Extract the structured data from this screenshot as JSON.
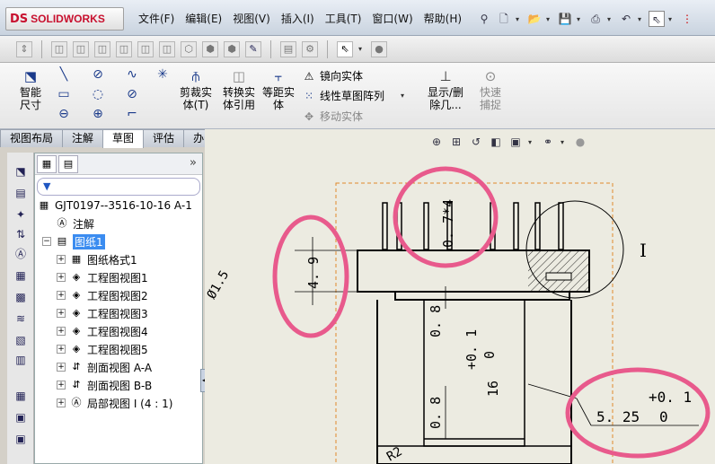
{
  "app": {
    "logo_text": "SOLIDWORKS",
    "logo_mark": "DS"
  },
  "menus": [
    "文件(F)",
    "编辑(E)",
    "视图(V)",
    "插入(I)",
    "工具(T)",
    "窗口(W)",
    "帮助(H)"
  ],
  "command_manager": {
    "smart_dimension": "智能尺寸",
    "trim_entities": "剪裁实体(T)",
    "convert_entities": "转换实体引用",
    "offset_entities": "等距实体",
    "mirror_entities": "镜向实体",
    "linear_pattern": "线性草图阵列",
    "move_entities": "移动实体",
    "show_delete_relations": "显示/删除几...",
    "quick_snaps": "快速捕捉"
  },
  "tabs": [
    "视图布局",
    "注解",
    "草图",
    "评估",
    "办公室产品"
  ],
  "active_tab": "草图",
  "feature_tree": {
    "root": "GJT0197--3516-10-16 A-1",
    "items": [
      {
        "label": "注解",
        "level": 1,
        "icon": "annotation-icon",
        "expand": ""
      },
      {
        "label": "图纸1",
        "level": 1,
        "icon": "sheet-icon",
        "expand": "−",
        "selected": true
      },
      {
        "label": "图纸格式1",
        "level": 2,
        "icon": "sheet-format-icon",
        "expand": "+"
      },
      {
        "label": "工程图视图1",
        "level": 2,
        "icon": "drawing-view-icon",
        "expand": "+"
      },
      {
        "label": "工程图视图2",
        "level": 2,
        "icon": "drawing-view-icon",
        "expand": "+"
      },
      {
        "label": "工程图视图3",
        "level": 2,
        "icon": "drawing-view-icon",
        "expand": "+"
      },
      {
        "label": "工程图视图4",
        "level": 2,
        "icon": "drawing-view-icon",
        "expand": "+"
      },
      {
        "label": "工程图视图5",
        "level": 2,
        "icon": "drawing-view-icon",
        "expand": "+"
      },
      {
        "label": "剖面视图 A-A",
        "level": 2,
        "icon": "section-view-icon",
        "expand": "+"
      },
      {
        "label": "剖面视图 B-B",
        "level": 2,
        "icon": "section-view-icon",
        "expand": "+"
      },
      {
        "label": "局部视图 I (4 : 1)",
        "level": 2,
        "icon": "detail-view-icon",
        "expand": "+"
      }
    ]
  },
  "drawing": {
    "dim_top": "0. 7*4",
    "dim_left": "4. 9",
    "dim_left_arc": "Ø1.5",
    "dim_08_upper": "0. 8",
    "dim_08_lower": "0. 8",
    "tol_plus": "+0. 1",
    "tol_zero": "0",
    "dim_16": "16",
    "detail_label": "I",
    "dim_525": "5. 25",
    "tol2_plus": "+0. 1",
    "tol2_zero": "0",
    "r_label": "R2"
  },
  "colors": {
    "highlight_circle": "#e85a8c",
    "border_dashed": "#e08a2a",
    "tree_selected": "#3b8cf0"
  }
}
